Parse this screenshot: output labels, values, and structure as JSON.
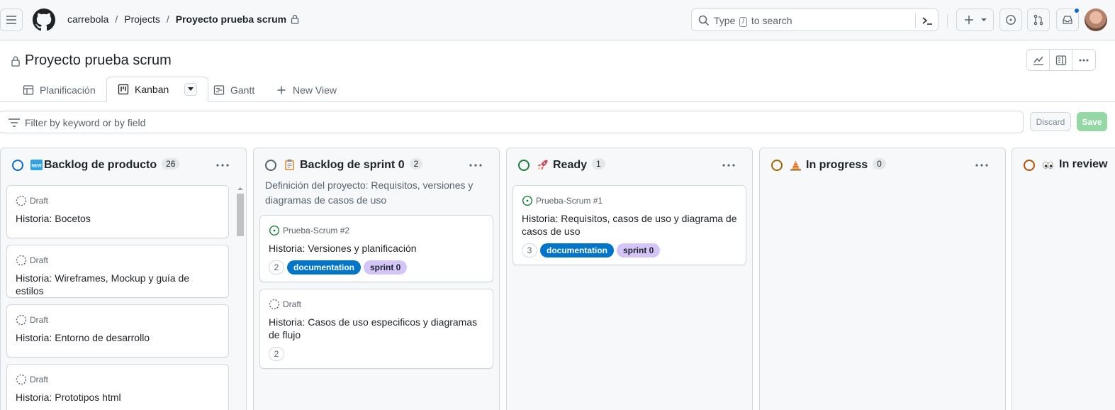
{
  "header": {
    "breadcrumb": [
      "carrebola",
      "Projects",
      "Proyecto prueba scrum"
    ],
    "search_placeholder_pre": "Type",
    "search_slash": "/",
    "search_placeholder_post": "to search"
  },
  "project": {
    "title": "Proyecto prueba scrum"
  },
  "tabs": [
    {
      "label": "Planificación",
      "icon": "table-icon"
    },
    {
      "label": "Kanban",
      "icon": "board-icon",
      "active": true
    },
    {
      "label": "Gantt",
      "icon": "roadmap-icon"
    },
    {
      "label": "New View",
      "icon": "plus-icon"
    }
  ],
  "filter": {
    "placeholder": "Filter by keyword or by field",
    "discard_label": "Discard",
    "save_label": "Save"
  },
  "columns": [
    {
      "title": "Backlog de producto",
      "count": "26",
      "emoji": "new-badge-icon",
      "status_color": "#0969da",
      "description": "",
      "cards": [
        {
          "meta": "Draft",
          "title": "Historia: Bocetos"
        },
        {
          "meta": "Draft",
          "title": "Historia: Wireframes, Mockup y guía de estilos"
        },
        {
          "meta": "Draft",
          "title": "Historia: Entorno de desarrollo"
        },
        {
          "meta": "Draft",
          "title": "Historia: Prototipos html"
        }
      ]
    },
    {
      "title": "Backlog de sprint 0",
      "count": "2",
      "emoji": "clipboard-icon",
      "status_color": "#59636e",
      "description": "Definición del proyecto: Requisitos, versiones y diagramas de casos de uso",
      "cards": [
        {
          "meta": "Prueba-Scrum #2",
          "title": "Historia: Versiones y planificación",
          "points": "2",
          "labels": [
            "documentation",
            "sprint 0"
          ]
        },
        {
          "meta": "Draft",
          "title": "Historia: Casos de uso especificos y diagramas de flujo",
          "points": "2"
        }
      ]
    },
    {
      "title": "Ready",
      "count": "1",
      "emoji": "rocket-icon",
      "status_color": "#1a7f37",
      "description": "",
      "cards": [
        {
          "meta": "Prueba-Scrum #1",
          "title": "Historia: Requisitos, casos de uso y diagrama de casos de uso",
          "points": "3",
          "labels": [
            "documentation",
            "sprint 0"
          ]
        }
      ]
    },
    {
      "title": "In progress",
      "count": "0",
      "emoji": "construction-icon",
      "status_color": "#9a6700",
      "description": "",
      "cards": []
    },
    {
      "title": "In review",
      "emoji": "eyes-icon",
      "status_color": "#bc4c00",
      "description": "",
      "cards": []
    }
  ]
}
